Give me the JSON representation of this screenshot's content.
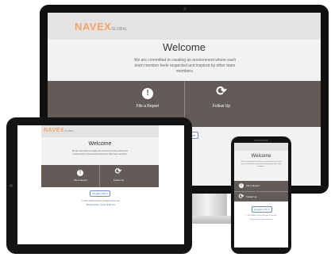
{
  "brand": {
    "logo_main": "NAVEX",
    "logo_sub": "GLOBAL",
    "logo_color": "#f3a46b"
  },
  "page": {
    "welcome_title": "Welcome",
    "welcome_text": "We are committed to creating an environment where each team member feels respected and inspired by other team members.",
    "file_report_label": "File a Report",
    "follow_up_label": "Follow Up",
    "report_icon": "exclamation-circle-icon",
    "follow_up_icon": "refresh-arrows-icon",
    "band_color": "#625b58"
  },
  "language": {
    "selected": "English (US)"
  },
  "footer": {
    "line1": "© 2019 NAVEX Global. All Rights Reserved.",
    "privacy_link": "Privacy Policy",
    "separator": " | ",
    "terms_link": "Terms of Service"
  }
}
